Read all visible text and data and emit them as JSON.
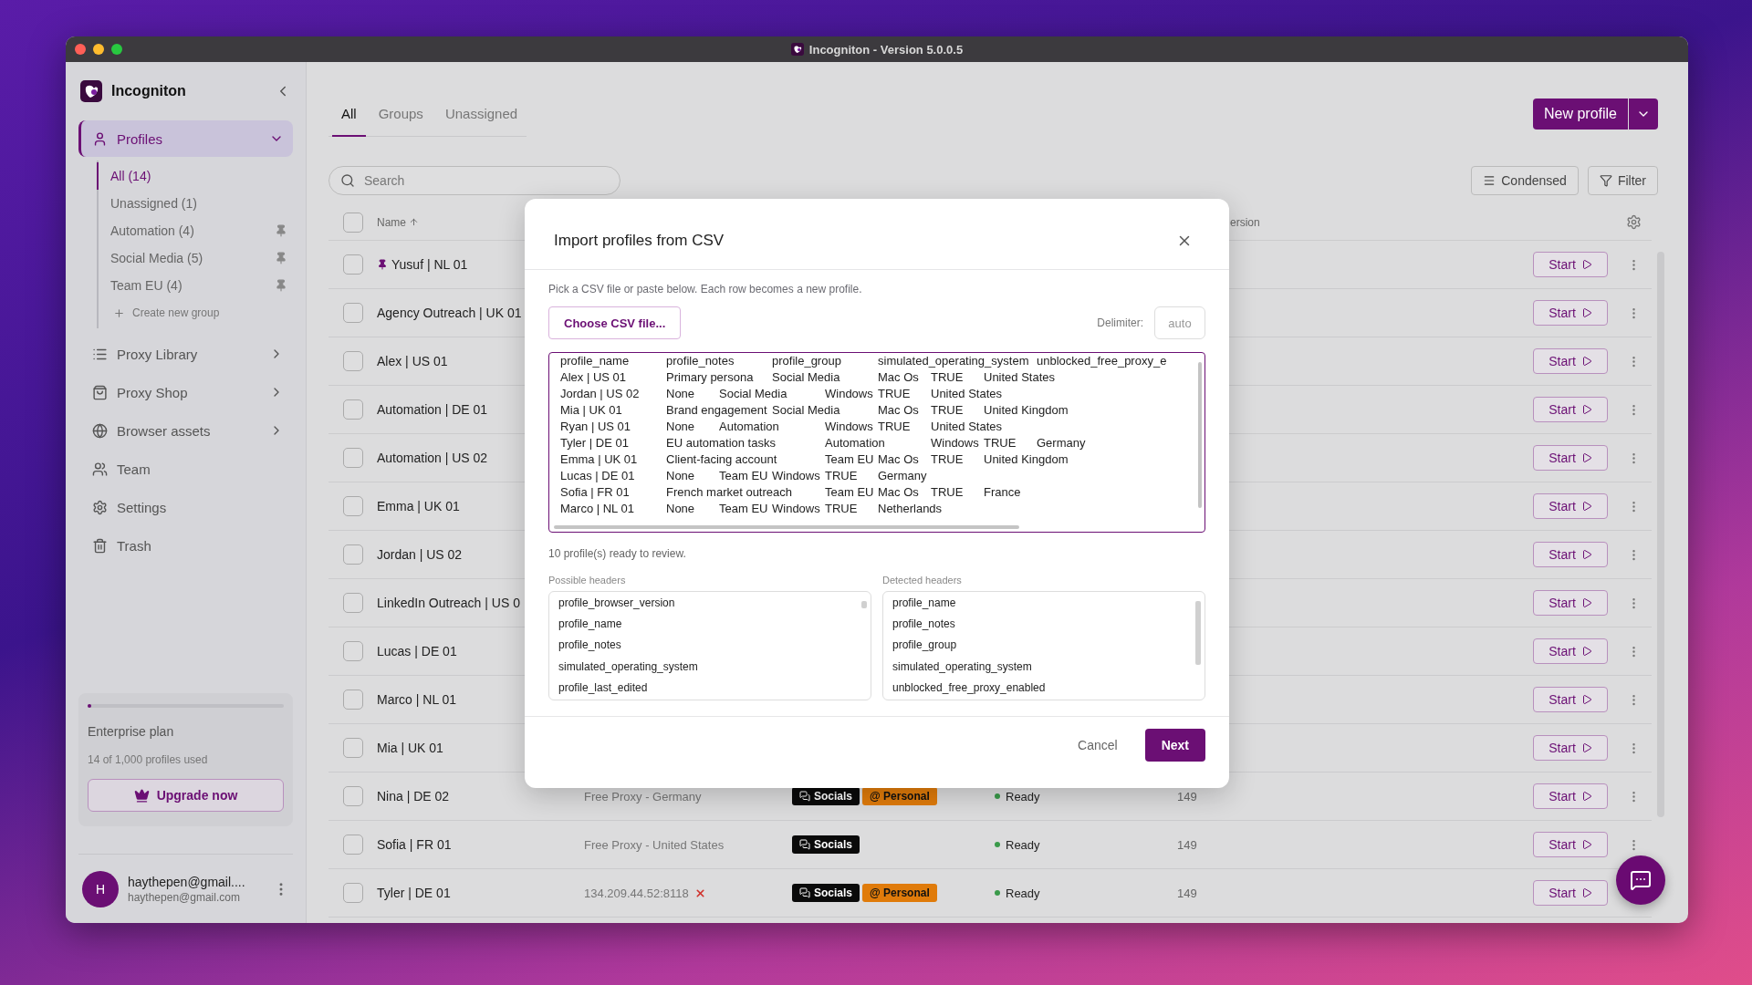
{
  "window": {
    "title": "Incogniton - Version 5.0.0.5"
  },
  "sidebar": {
    "brand": "Incogniton",
    "nav": [
      {
        "label": "Profiles",
        "selected": true,
        "expanded": true,
        "create_group": "Create new group",
        "children": [
          {
            "label": "All (14)",
            "selected": true,
            "pinned": false
          },
          {
            "label": "Unassigned (1)",
            "selected": false,
            "pinned": false
          },
          {
            "label": "Automation (4)",
            "selected": false,
            "pinned": true
          },
          {
            "label": "Social Media (5)",
            "selected": false,
            "pinned": true
          },
          {
            "label": "Team EU (4)",
            "selected": false,
            "pinned": true
          }
        ]
      },
      {
        "label": "Proxy Library",
        "selected": false,
        "expandable": true
      },
      {
        "label": "Proxy Shop",
        "selected": false,
        "expandable": true
      },
      {
        "label": "Browser assets",
        "selected": false,
        "expandable": true
      },
      {
        "label": "Team",
        "selected": false,
        "expandable": false
      },
      {
        "label": "Settings",
        "selected": false,
        "expandable": false
      },
      {
        "label": "Trash",
        "selected": false,
        "expandable": false
      }
    ],
    "plan": {
      "level": 0.014,
      "name": "Enterprise plan",
      "usage": "14 of 1,000 profiles used",
      "button": "Upgrade now"
    },
    "user": {
      "initial": "H",
      "name": "haythepen@gmail....",
      "email": "haythepen@gmail.com"
    }
  },
  "tabs": [
    {
      "label": "All",
      "selected": true
    },
    {
      "label": "Groups",
      "selected": false
    },
    {
      "label": "Unassigned",
      "selected": false
    }
  ],
  "new_profile_button": "New profile",
  "search": {
    "placeholder": "Search"
  },
  "toolbar_buttons": [
    "Condensed",
    "Filter"
  ],
  "table": {
    "header_checked": false,
    "name_header": "Name",
    "sorted_ascending": true,
    "column_5": "ersion",
    "rows": [
      {
        "name": "Yusuf | NL 01",
        "pinned": true,
        "checked": false,
        "action": "Start"
      },
      {
        "name": "Agency Outreach | UK 01",
        "pinned": false,
        "checked": false,
        "action": "Start"
      },
      {
        "name": "Alex | US 01",
        "pinned": false,
        "checked": false,
        "action": "Start"
      },
      {
        "name": "Automation | DE 01",
        "pinned": false,
        "checked": false,
        "action": "Start"
      },
      {
        "name": "Automation | US 02",
        "pinned": false,
        "checked": false,
        "action": "Start"
      },
      {
        "name": "Emma | UK 01",
        "pinned": false,
        "checked": false,
        "action": "Start"
      },
      {
        "name": "Jordan | US 02",
        "pinned": false,
        "checked": false,
        "action": "Start"
      },
      {
        "name": "LinkedIn Outreach | US 0",
        "pinned": false,
        "checked": false,
        "action": "Start"
      },
      {
        "name": "Lucas | DE 01",
        "pinned": false,
        "checked": false,
        "action": "Start"
      },
      {
        "name": "Marco | NL 01",
        "pinned": false,
        "checked": false,
        "action": "Start"
      },
      {
        "name": "Mia | UK 01",
        "pinned": false,
        "checked": false,
        "action": "Start"
      },
      {
        "name": "Nina | DE 02",
        "pinned": false,
        "checked": false,
        "proxy": "Free Proxy - Germany",
        "proxy_error": false,
        "tags": [
          {
            "label": "Socials",
            "kind": "chat",
            "color": "#0a0a0a"
          },
          {
            "label": "@ Personal",
            "kind": "plain",
            "color": "#e07b0a"
          }
        ],
        "status": "Ready",
        "version": "149",
        "action": "Start"
      },
      {
        "name": "Sofia | FR 01",
        "pinned": false,
        "checked": false,
        "proxy": "Free Proxy - United States",
        "proxy_error": false,
        "tags": [
          {
            "label": "Socials",
            "kind": "chat",
            "color": "#0a0a0a"
          }
        ],
        "status": "Ready",
        "version": "149",
        "action": "Start"
      },
      {
        "name": "Tyler | DE 01",
        "pinned": false,
        "checked": false,
        "proxy": "134.209.44.52:8118",
        "proxy_error": true,
        "tags": [
          {
            "label": "Socials",
            "kind": "chat",
            "color": "#0a0a0a"
          },
          {
            "label": "@ Personal",
            "kind": "plain",
            "color": "#e07b0a"
          }
        ],
        "status": "Ready",
        "version": "149",
        "action": "Start"
      }
    ]
  },
  "modal": {
    "title": "Import profiles from CSV",
    "description": "Pick a CSV file or paste below. Each row becomes a new profile.",
    "choose_button": "Choose CSV file...",
    "delimiter_label": "Delimiter:",
    "delimiter_placeholder": "auto",
    "csv_lines": [
      "profile_name\tprofile_notes\tprofile_group\tsimulated_operating_system\tunblocked_free_proxy_e",
      "Alex | US 01\tPrimary persona\tSocial Media\tMac Os\tTRUE\tUnited States",
      "Jordan | US 02\tNone\tSocial Media\tWindows\tTRUE\tUnited States",
      "Mia | UK 01\tBrand engagement\tSocial Media\tMac Os\tTRUE\tUnited Kingdom",
      "Ryan | US 01\tNone\tAutomation\tWindows\tTRUE\tUnited States",
      "Tyler | DE 01\tEU automation tasks\tAutomation\tWindows\tTRUE\tGermany",
      "Emma | UK 01\tClient-facing account\tTeam EU\tMac Os\tTRUE\tUnited Kingdom",
      "Lucas | DE 01\tNone\tTeam EU\tWindows\tTRUE\tGermany",
      "Sofia | FR 01\tFrench market outreach\tTeam EU\tMac Os\tTRUE\tFrance",
      "Marco | NL 01\tNone\tTeam EU\tWindows\tTRUE\tNetherlands"
    ],
    "summary": "10 profile(s) ready to review.",
    "possible_headers": {
      "label": "Possible headers",
      "items": [
        "profile_browser_version",
        "profile_name",
        "profile_notes",
        "simulated_operating_system",
        "profile_last_edited"
      ]
    },
    "detected_headers": {
      "label": "Detected headers",
      "items": [
        "profile_name",
        "profile_notes",
        "profile_group",
        "simulated_operating_system",
        "unblocked_free_proxy_enabled"
      ]
    },
    "cancel": "Cancel",
    "next": "Next"
  }
}
